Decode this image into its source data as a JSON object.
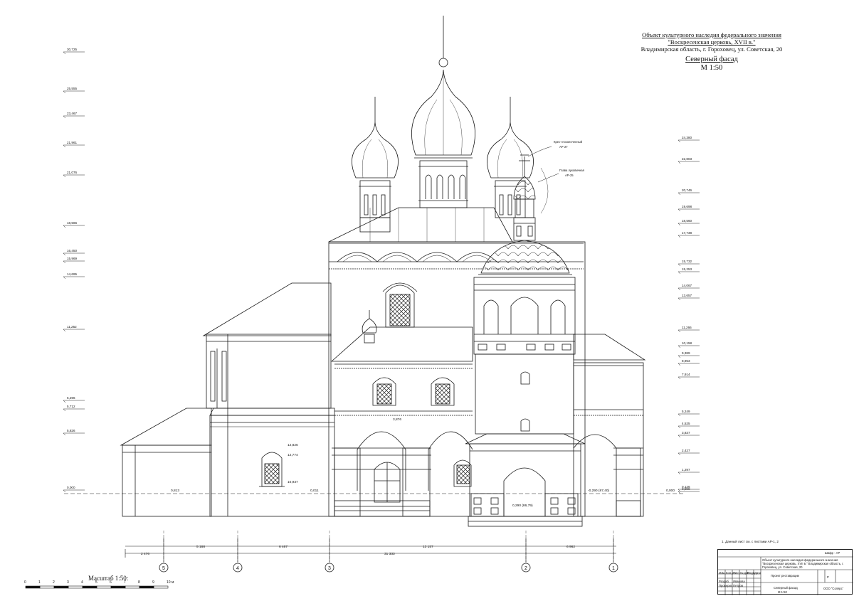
{
  "title": {
    "line1": "Объект культурного наследия федерального значения",
    "line2": "\"Воскресенская церковь, XVII в.\"",
    "line3": "Владимирская область, г. Гороховец, ул. Советская, 20",
    "sheet_name": "Северный фасад",
    "scale": "М 1:50"
  },
  "left_marks": [
    "30,725",
    "25,555",
    "23,467",
    "21,961",
    "21,076",
    "18,566",
    "16,450",
    "15,969",
    "14,695",
    "11,252",
    "6,296",
    "5,712",
    "5,826",
    "0,000"
  ],
  "right_marks": [
    "24,380",
    "22,803",
    "20,746",
    "19,698",
    "18,560",
    "17,738",
    "15,732",
    "15,253",
    "14,067",
    "13,657",
    "11,266",
    "10,158",
    "9,389",
    "8,953",
    "7,914",
    "5,249",
    "4,525",
    "3,837",
    "2,427",
    "1,297",
    "0,126",
    "0,000"
  ],
  "inner_marks": {
    "window_top": "12,826",
    "window_mid": "12,774",
    "window_bot": "10,937",
    "door_top": "3,876",
    "door_sill": "0,813",
    "ground_a": "0,011",
    "ground_b": "0,290 (86,79)",
    "ground_c": "-0,290 (87,40)",
    "porch_level": "0,000"
  },
  "callouts": {
    "cross": "Крест позолоченный",
    "cross_ref": "АР-27",
    "dome": "Глава луковичная",
    "dome_ref": "АР-25"
  },
  "dimensions": {
    "segments": [
      "5 168",
      "6 467",
      "13 157",
      "6 962"
    ],
    "overall": "31 333",
    "left_offset": "2 476"
  },
  "axes": [
    "5",
    "4",
    "3",
    "2",
    "1"
  ],
  "scale_bar": {
    "label": "Масштаб  1:50:",
    "ticks": [
      "0",
      "1",
      "2",
      "3",
      "4",
      "5",
      "6",
      "7",
      "8",
      "9",
      "10 м"
    ]
  },
  "note": "1. Данный лист см. с листами АР-1, 2",
  "stamp": {
    "code": "Шифр - АР",
    "object": "Объект культурного наследия федерального значения \"Воскресенская церковь, XVII в.\" Владимирская область, г. Гороховец, ул. Советская, 20",
    "project": "Проект реставрации",
    "sheet_title": "Северный фасад",
    "sheet_scale": "М 1:50",
    "company": "ООО \"Солярс\"",
    "stage": "Р",
    "heads": [
      "Изм.",
      "Кол.уч",
      "Лист",
      "№ док",
      "Подп.",
      "Дата"
    ],
    "role1": "Разраб.",
    "role2": "Проверил",
    "name1": "Иванова",
    "name2": "Петров"
  },
  "colors": {
    "ink": "#1a1a1a",
    "paper": "#ffffff"
  }
}
